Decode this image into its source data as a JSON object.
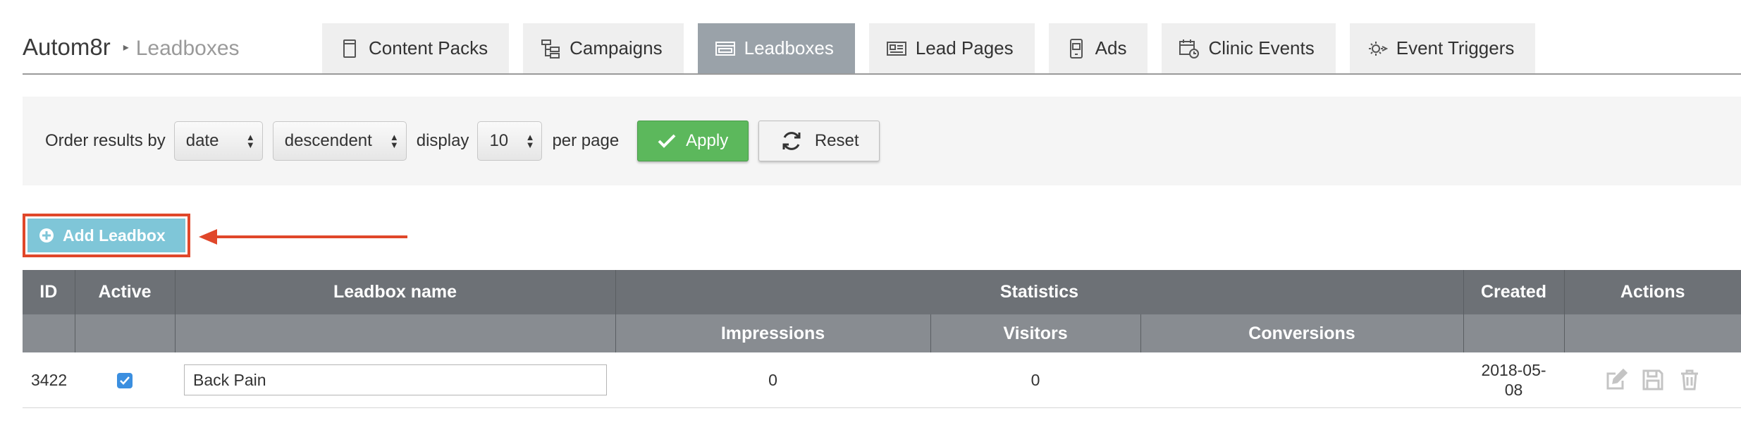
{
  "breadcrumb": {
    "app": "Autom8r",
    "separator": "▸",
    "current": "Leadboxes"
  },
  "tabs": [
    {
      "label": "Content Packs",
      "icon": "document-icon",
      "active": false
    },
    {
      "label": "Campaigns",
      "icon": "sitemap-icon",
      "active": false
    },
    {
      "label": "Leadboxes",
      "icon": "leadbox-icon",
      "active": true
    },
    {
      "label": "Lead Pages",
      "icon": "newspaper-icon",
      "active": false
    },
    {
      "label": "Ads",
      "icon": "ads-icon",
      "active": false
    },
    {
      "label": "Clinic Events",
      "icon": "calendar-clock-icon",
      "active": false
    },
    {
      "label": "Event Triggers",
      "icon": "gear-trigger-icon",
      "active": false
    }
  ],
  "filters": {
    "order_label": "Order results by",
    "order_by": "date",
    "direction": "descendent",
    "display_label": "display",
    "per_page": "10",
    "per_page_label": "per page",
    "apply_label": "Apply",
    "reset_label": "Reset"
  },
  "add_button": {
    "label": "Add Leadbox"
  },
  "table": {
    "headers": {
      "id": "ID",
      "active": "Active",
      "name": "Leadbox name",
      "statistics": "Statistics",
      "created": "Created",
      "actions": "Actions",
      "impressions": "Impressions",
      "visitors": "Visitors",
      "conversions": "Conversions"
    },
    "rows": [
      {
        "id": "3422",
        "active": true,
        "name": "Back Pain",
        "impressions": "0",
        "visitors": "0",
        "conversions": "",
        "created": "2018-05-\n08"
      }
    ]
  },
  "colors": {
    "active_tab": "#9aa2a9",
    "apply_green": "#5cb85c",
    "add_button": "#7fc6d8",
    "annotation_red": "#e0472a",
    "header_dark": "#6d7176",
    "header_light": "#888c91"
  }
}
